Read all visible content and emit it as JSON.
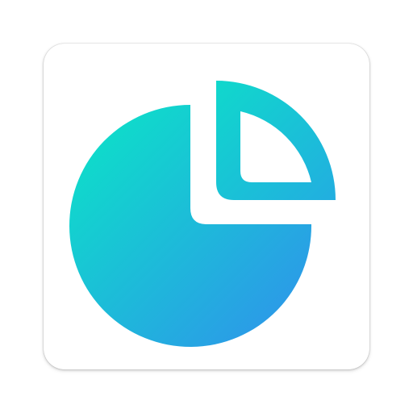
{
  "icon": {
    "name": "pie-chart-icon",
    "gradient_start": "#0AE6C6",
    "gradient_end": "#3090EC",
    "tile_color": "#FFFFFF"
  }
}
